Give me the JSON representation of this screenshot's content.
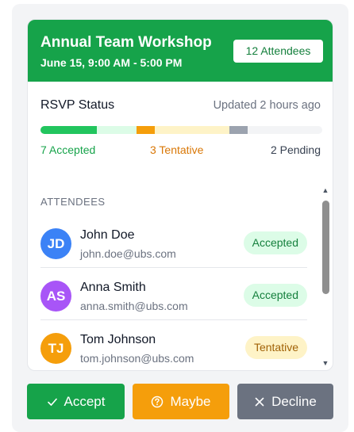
{
  "event": {
    "title": "Annual Team Workshop",
    "date": "June 15, 9:00 AM - 5:00 PM",
    "attendee_count_label": "12 Attendees"
  },
  "rsvp": {
    "title": "RSVP Status",
    "updated": "Updated 2 hours ago",
    "accepted_label": "7 Accepted",
    "tentative_label": "3 Tentative",
    "pending_label": "2 Pending",
    "progress_fractions": {
      "accepted": 0.2,
      "accepted_light": 0.14,
      "tentative": 0.065,
      "tentative_light": 0.265,
      "pending": 0.065
    },
    "colors": {
      "accepted": "#22c55e",
      "accepted_light": "#dcfce7",
      "tentative": "#f59e0b",
      "tentative_light": "#fef3c7",
      "pending": "#9ca3af"
    }
  },
  "attendees": {
    "section_title": "ATTENDEES",
    "items": [
      {
        "initials": "JD",
        "name": "John Doe",
        "email": "john.doe@ubs.com",
        "status": "Accepted",
        "avatar_color": "#3b82f6"
      },
      {
        "initials": "AS",
        "name": "Anna Smith",
        "email": "anna.smith@ubs.com",
        "status": "Accepted",
        "avatar_color": "#a855f7"
      },
      {
        "initials": "TJ",
        "name": "Tom Johnson",
        "email": "tom.johnson@ubs.com",
        "status": "Tentative",
        "avatar_color": "#f59e0b"
      }
    ]
  },
  "actions": {
    "accept": "Accept",
    "maybe": "Maybe",
    "decline": "Decline"
  },
  "icons": {
    "accept": "check-icon",
    "maybe": "question-circle-icon",
    "decline": "x-icon",
    "scroll_up": "triangle-up-icon",
    "scroll_down": "triangle-down-icon"
  },
  "colors": {
    "brand": "#16a34a",
    "maybe": "#f59e0b",
    "decline": "#6b7280"
  }
}
